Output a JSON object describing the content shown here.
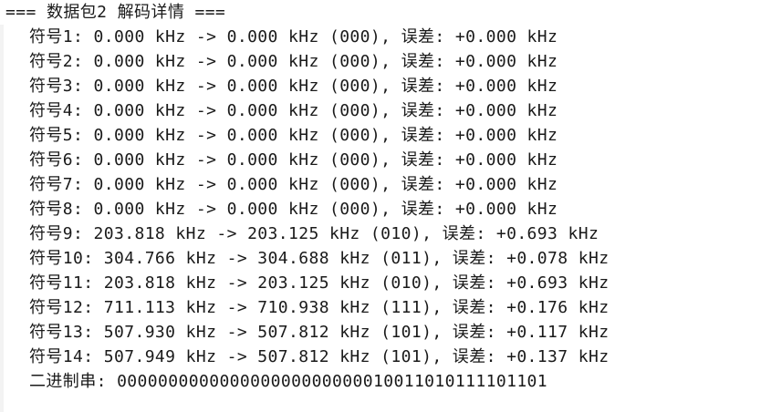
{
  "console": {
    "header": "=== 数据包2 解码详情 ===",
    "lines": [
      "符号1: 0.000 kHz -> 0.000 kHz (000), 误差: +0.000 kHz",
      "符号2: 0.000 kHz -> 0.000 kHz (000), 误差: +0.000 kHz",
      "符号3: 0.000 kHz -> 0.000 kHz (000), 误差: +0.000 kHz",
      "符号4: 0.000 kHz -> 0.000 kHz (000), 误差: +0.000 kHz",
      "符号5: 0.000 kHz -> 0.000 kHz (000), 误差: +0.000 kHz",
      "符号6: 0.000 kHz -> 0.000 kHz (000), 误差: +0.000 kHz",
      "符号7: 0.000 kHz -> 0.000 kHz (000), 误差: +0.000 kHz",
      "符号8: 0.000 kHz -> 0.000 kHz (000), 误差: +0.000 kHz",
      "符号9: 203.818 kHz -> 203.125 kHz (010), 误差: +0.693 kHz",
      "符号10: 304.766 kHz -> 304.688 kHz (011), 误差: +0.078 kHz",
      "符号11: 203.818 kHz -> 203.125 kHz (010), 误差: +0.693 kHz",
      "符号12: 711.113 kHz -> 710.938 kHz (111), 误差: +0.176 kHz",
      "符号13: 507.930 kHz -> 507.812 kHz (101), 误差: +0.117 kHz",
      "符号14: 507.949 kHz -> 507.812 kHz (101), 误差: +0.137 kHz"
    ],
    "binary": "二进制串: 000000000000000000000000010011010111101101"
  }
}
